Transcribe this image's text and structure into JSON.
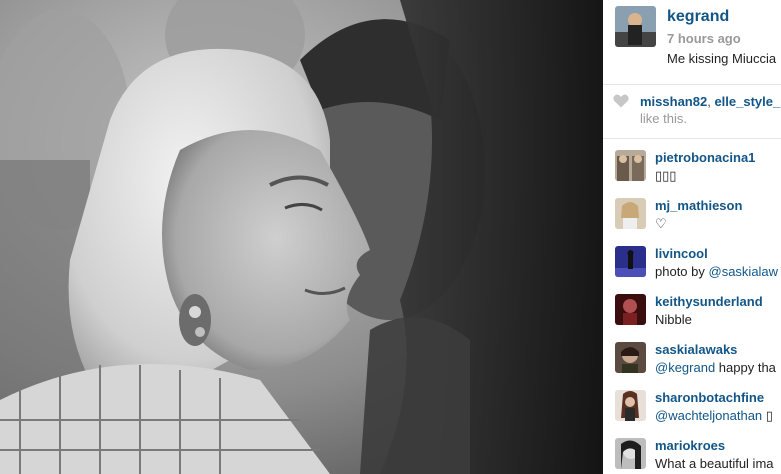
{
  "post": {
    "photo_alt": "photo",
    "owner": {
      "username": "kegrand",
      "time": "7 hours ago",
      "caption": "Me kissing Miuccia"
    },
    "likes": {
      "users": [
        "misshan82",
        "elle_style_"
      ],
      "separator": ", ",
      "suffix": "like this."
    },
    "comments": [
      {
        "username": "pietrobonacina1",
        "text": "▯▯▯",
        "avatar_color": "#7a6a5c"
      },
      {
        "username": "mj_mathieson",
        "text": "♡",
        "avatar_color": "#c9b9a0"
      },
      {
        "username": "livincool",
        "text_prefix": "photo by ",
        "mention": "@saskialaw",
        "avatar_color": "#3a3f9c"
      },
      {
        "username": "keithysunderland",
        "text": "Nibble",
        "avatar_color": "#5a1a1a"
      },
      {
        "username": "saskialawaks",
        "mention": "@kegrand",
        "text_suffix": " happy tha",
        "avatar_color": "#4a3a32"
      },
      {
        "username": "sharonbotachfine",
        "mention": "@wachteljonathan",
        "text_suffix": " ▯",
        "avatar_color": "#6a4030"
      },
      {
        "username": "mariokroes",
        "text": "What a beautiful ima",
        "avatar_color": "#2a2a2a"
      }
    ]
  },
  "icons": {
    "like": "heart-icon"
  },
  "colors": {
    "link": "#125688",
    "muted": "#999999",
    "text": "#222222"
  }
}
